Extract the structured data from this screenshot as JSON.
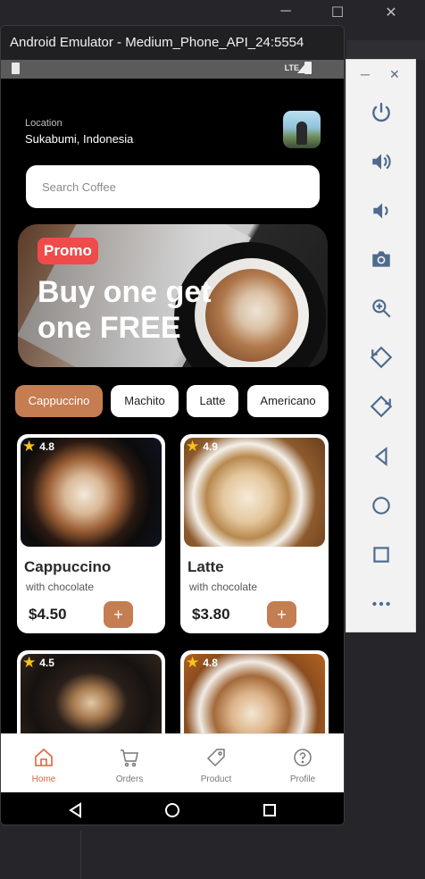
{
  "emulator": {
    "title": "Android Emulator - Medium_Phone_API_24:5554",
    "status_lte": "LTE"
  },
  "header": {
    "location_label": "Location",
    "location_value": "Sukabumi, Indonesia"
  },
  "search": {
    "placeholder": "Search Coffee"
  },
  "promo": {
    "badge": "Promo",
    "headline": "Buy one get one FREE"
  },
  "categories": [
    {
      "label": "Cappuccino",
      "active": true
    },
    {
      "label": "Machito",
      "active": false
    },
    {
      "label": "Latte",
      "active": false
    },
    {
      "label": "Americano",
      "active": false
    }
  ],
  "products": [
    {
      "name": "Cappuccino",
      "desc": "with chocolate",
      "price": "$4.50",
      "rating": "4.8"
    },
    {
      "name": "Latte",
      "desc": "with chocolate",
      "price": "$3.80",
      "rating": "4.9"
    },
    {
      "name": "",
      "desc": "",
      "price": "",
      "rating": "4.5"
    },
    {
      "name": "",
      "desc": "",
      "price": "",
      "rating": "4.8"
    }
  ],
  "add_symbol": "+",
  "bottom_nav": [
    {
      "label": "Home",
      "icon": "home-icon",
      "active": true
    },
    {
      "label": "Orders",
      "icon": "cart-icon",
      "active": false
    },
    {
      "label": "Product",
      "icon": "tag-icon",
      "active": false
    },
    {
      "label": "Profile",
      "icon": "help-circle-icon",
      "active": false
    }
  ],
  "side_panel": {
    "items": [
      "power-icon",
      "volume-up-icon",
      "volume-down-icon",
      "camera-icon",
      "zoom-icon",
      "rotate-left-icon",
      "rotate-right-icon",
      "back-icon",
      "home-icon",
      "overview-icon",
      "more-icon"
    ]
  },
  "colors": {
    "accent": "#c57d52",
    "promo_badge": "#ef4b4b",
    "nav_active": "#e2623b",
    "star": "#f7c21a"
  }
}
